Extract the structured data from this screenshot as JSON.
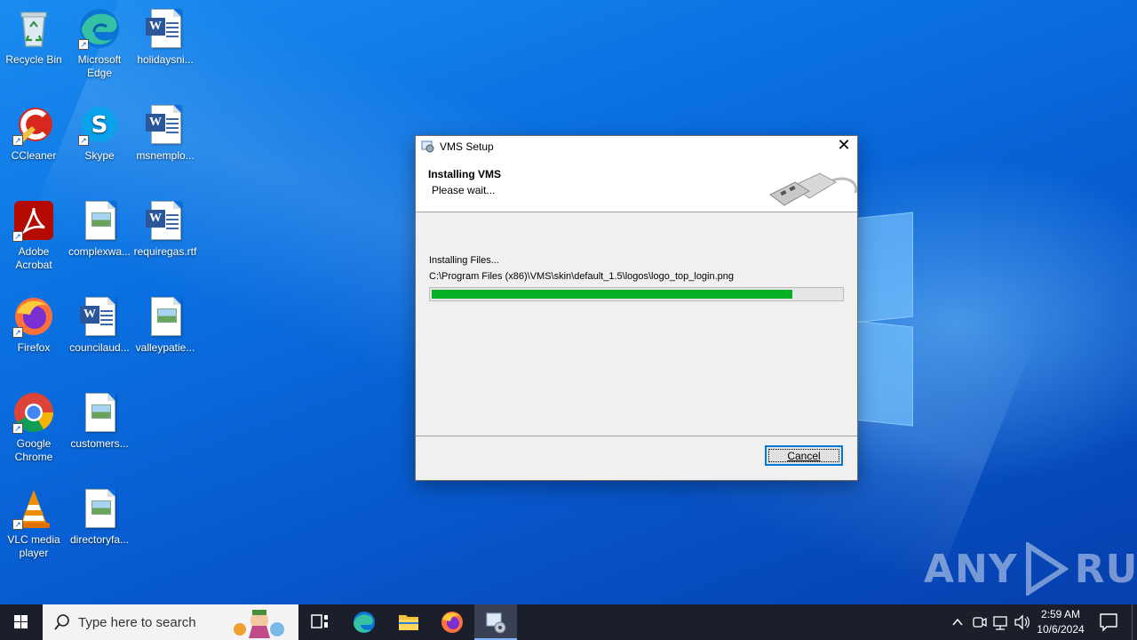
{
  "desktop": {
    "icons": [
      {
        "label": "Recycle Bin"
      },
      {
        "label": "Microsoft Edge"
      },
      {
        "label": "holidaysni..."
      },
      {
        "label": "CCleaner"
      },
      {
        "label": "Skype"
      },
      {
        "label": "msnemplo..."
      },
      {
        "label": "Adobe Acrobat"
      },
      {
        "label": "complexwa..."
      },
      {
        "label": "requiregas.rtf"
      },
      {
        "label": "Firefox"
      },
      {
        "label": "councilaud..."
      },
      {
        "label": "valleypatie..."
      },
      {
        "label": "Google Chrome"
      },
      {
        "label": "customers..."
      },
      {
        "label": "VLC media player"
      },
      {
        "label": "directoryfa..."
      }
    ]
  },
  "dialog": {
    "title": "VMS Setup",
    "header_title": "Installing VMS",
    "header_subtitle": "Please wait...",
    "status_line": "Installing Files...",
    "current_file": "C:\\Program Files (x86)\\VMS\\skin\\default_1.5\\logos\\logo_top_login.png",
    "progress_fraction": 0.88,
    "cancel_label": "Cancel",
    "progress_color": "#06b025"
  },
  "watermark": {
    "left": "ANY",
    "right": "RUN"
  },
  "taskbar": {
    "search_placeholder": "Type here to search",
    "time": "2:59 AM",
    "date": "10/6/2024"
  }
}
